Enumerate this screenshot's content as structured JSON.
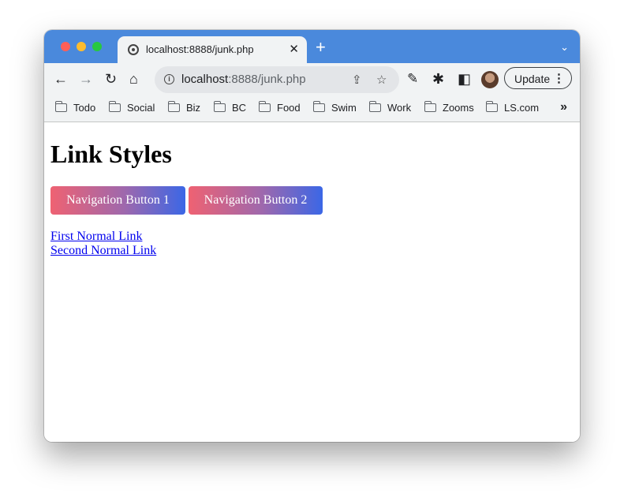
{
  "tab": {
    "title": "localhost:8888/junk.php",
    "close": "✕"
  },
  "newtab": "+",
  "tabsearch": "⌄",
  "address": {
    "host": "localhost",
    "rest": ":8888/junk.php",
    "info": "i"
  },
  "toolbar": {
    "back": "←",
    "forward": "→",
    "reload": "↻",
    "home": "⌂",
    "share": "⇪",
    "star": "☆",
    "eyedropper": "✎",
    "extensions": "✱",
    "sidepanel": "◧",
    "update_label": "Update",
    "menu": "⋮"
  },
  "bookmarks": [
    "Todo",
    "Social",
    "Biz",
    "BC",
    "Food",
    "Swim",
    "Work",
    "Zooms",
    "LS.com"
  ],
  "bookmarks_more": "»",
  "page": {
    "heading": "Link Styles",
    "nav_buttons": [
      "Navigation Button 1",
      "Navigation Button 2"
    ],
    "links": [
      "First Normal Link",
      "Second Normal Link"
    ]
  },
  "colors": {
    "tabstrip": "#4a89dc",
    "toolbar": "#f1f3f4",
    "gradient_start": "#ef6272",
    "gradient_end": "#3b67e6",
    "link": "#0000ee"
  }
}
